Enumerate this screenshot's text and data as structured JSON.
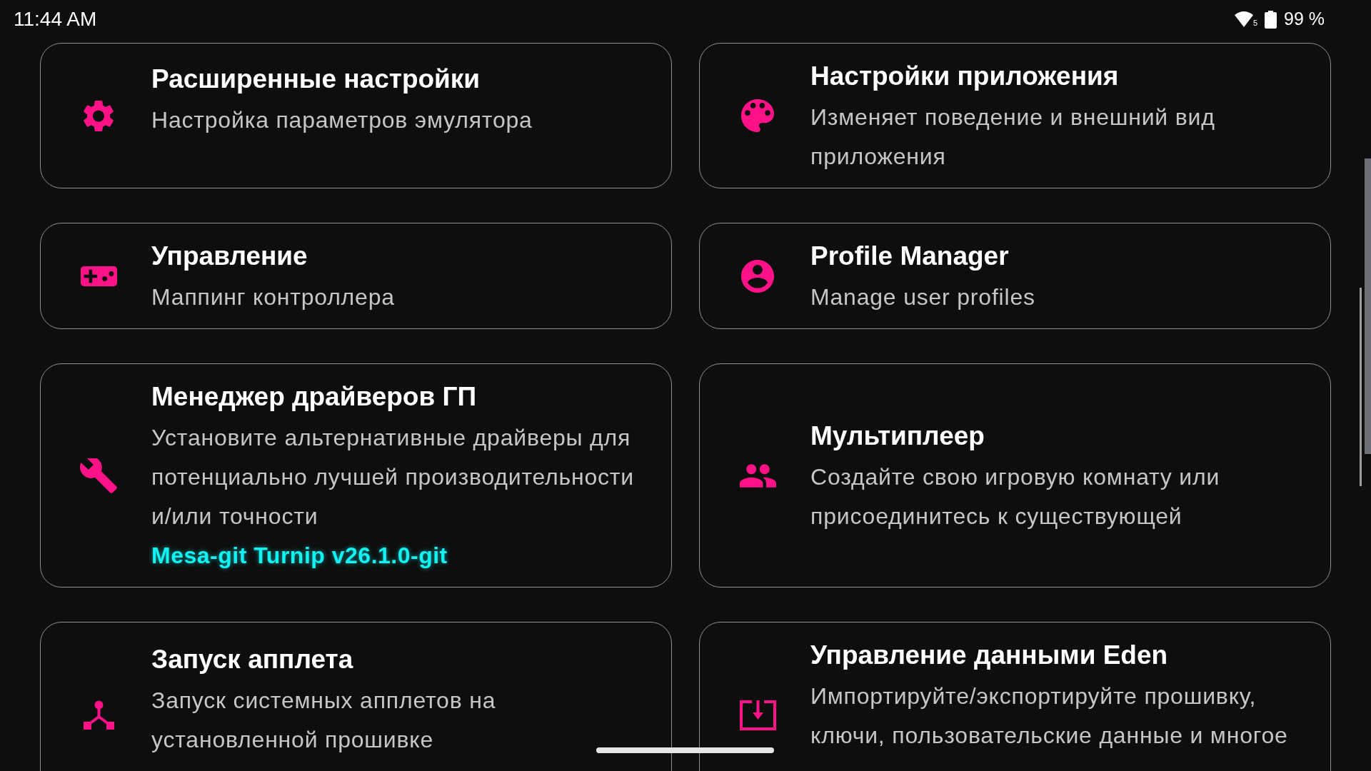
{
  "status_bar": {
    "time": "11:44 AM",
    "wifi_band": "5",
    "battery": "99 %"
  },
  "cards": [
    {
      "title": "Расширенные настройки",
      "description": "Настройка параметров эмулятора"
    },
    {
      "title": "Настройки приложения",
      "description": "Изменяет поведение и внешний вид приложения"
    },
    {
      "title": "Управление",
      "description": "Маппинг контроллера"
    },
    {
      "title": "Profile Manager",
      "description": "Manage user profiles"
    },
    {
      "title": "Менеджер драйверов ГП",
      "description": "Установите альтернативные драйверы для потенциально лучшей производительности и/или точности",
      "value": "Mesa-git Turnip v26.1.0-git"
    },
    {
      "title": "Мультиплеер",
      "description": "Создайте свою игровую комнату или присоединитесь к существующей"
    },
    {
      "title": "Запуск апплета",
      "description": "Запуск системных апплетов на установленной прошивке"
    },
    {
      "title": "Управление данными Eden",
      "description": "Импортируйте/экспортируйте прошивку, ключи, пользовательские данные и многое"
    }
  ]
}
